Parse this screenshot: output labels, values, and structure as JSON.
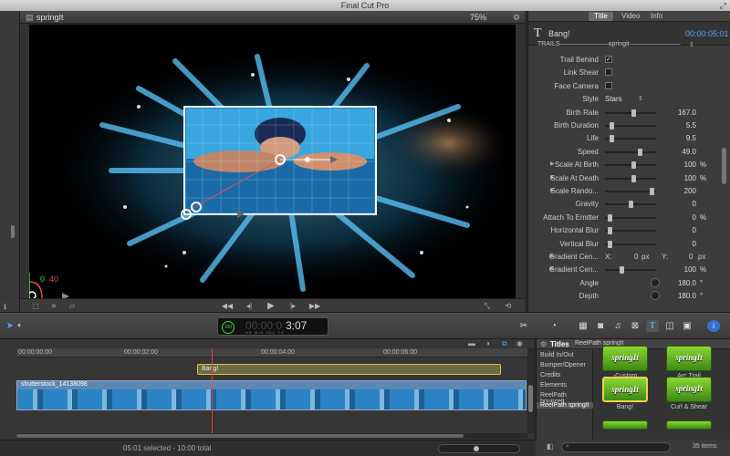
{
  "app": {
    "title": "Final Cut Pro"
  },
  "viewer": {
    "clip_name": "springIt",
    "zoom": "75%",
    "view_label": "",
    "overlay_values": {
      "a": "0",
      "b": "40"
    }
  },
  "inspector": {
    "tabs": [
      {
        "label": "Title",
        "active": true
      },
      {
        "label": "Video",
        "active": false
      },
      {
        "label": "Info",
        "active": false
      }
    ],
    "clip_title": "Bang!",
    "timecode": "00:00:05:01",
    "group_left": "TRAILS————————",
    "group_right": "springit————————",
    "params": [
      {
        "type": "check",
        "label": "Trail Behind",
        "checked": true
      },
      {
        "type": "check",
        "label": "Link Shear",
        "checked": false
      },
      {
        "type": "check",
        "label": "Face Camera",
        "checked": false
      },
      {
        "type": "select",
        "label": "Style",
        "value": "Stars"
      },
      {
        "type": "slider",
        "label": "Birth Rate",
        "value": "167.0",
        "pos": 0.55
      },
      {
        "type": "slider",
        "label": "Birth Duration",
        "value": "5.5",
        "pos": 0.1
      },
      {
        "type": "slider",
        "label": "Life",
        "value": "9.5",
        "pos": 0.1
      },
      {
        "type": "slider",
        "label": "Speed",
        "value": "49.0",
        "pos": 0.7
      },
      {
        "type": "slider",
        "label": "Scale At Birth",
        "value": "100",
        "unit": "%",
        "pos": 0.55,
        "tri": true
      },
      {
        "type": "slider",
        "label": "Scale At Death",
        "value": "100",
        "unit": "%",
        "pos": 0.55,
        "tri": true
      },
      {
        "type": "slider",
        "label": "Scale Rando...",
        "value": "200",
        "pos": 0.95,
        "tri": true
      },
      {
        "type": "slider",
        "label": "Gravity",
        "value": "0",
        "pos": 0.5
      },
      {
        "type": "slider",
        "label": "Attach To Emitter",
        "value": "0",
        "unit": "%",
        "pos": 0.05
      },
      {
        "type": "slider",
        "label": "Horizontal Blur",
        "value": "0",
        "pos": 0.05
      },
      {
        "type": "slider",
        "label": "Vertical Blur",
        "value": "0",
        "pos": 0.05
      },
      {
        "type": "xy",
        "label": "Gradient Cen...",
        "x": "0",
        "xunit": "px",
        "y": "0",
        "yunit": "px",
        "tri": true
      },
      {
        "type": "slider",
        "label": "Gradient Cen...",
        "value": "100",
        "unit": "%",
        "pos": 0.3,
        "tri": true
      },
      {
        "type": "dial",
        "label": "Angle",
        "value": "180.0",
        "unit": "°"
      },
      {
        "type": "dial",
        "label": "Depth",
        "value": "180.0",
        "unit": "°"
      }
    ]
  },
  "toolbar": {
    "timecode_digits": "00:00:03:07",
    "timecode_main": "3:07",
    "timecode_prefix": "00:00:0",
    "percent": "100",
    "timecode_labels": "HR  MIN  SEC  FR"
  },
  "timeline": {
    "ruler": [
      "00:00:00:00",
      "00:00:02:00",
      "00:00:04:00",
      "00:00:06:00"
    ],
    "title_clip": "Bang!",
    "video_clip": "shutterstock_14138098"
  },
  "browser": {
    "header": "Titles",
    "breadcrumb": "ReelPath springIt",
    "list": [
      "Build In/Out",
      "Bumper/Opener",
      "Credits",
      "Elements",
      "ReelPath bouncelt",
      "ReelPath springIt"
    ],
    "selected_index": 5,
    "thumbs": [
      {
        "text": "springIt",
        "caption": "-Custom",
        "selected": false
      },
      {
        "text": "springIt",
        "caption": "Arc Trail",
        "selected": false
      },
      {
        "text": "springIt",
        "caption": "Bang!",
        "selected": true
      },
      {
        "text": "springIt",
        "caption": "Curl & Shear",
        "selected": false
      }
    ],
    "item_count": "35 items"
  },
  "status": {
    "selection": "05:01 selected - 10:00 total"
  },
  "colors": {
    "accent": "#5aa0ff",
    "title_clip": "#e7c140",
    "video_clip": "#5d88b4",
    "thumb_green": "#8bd633"
  }
}
